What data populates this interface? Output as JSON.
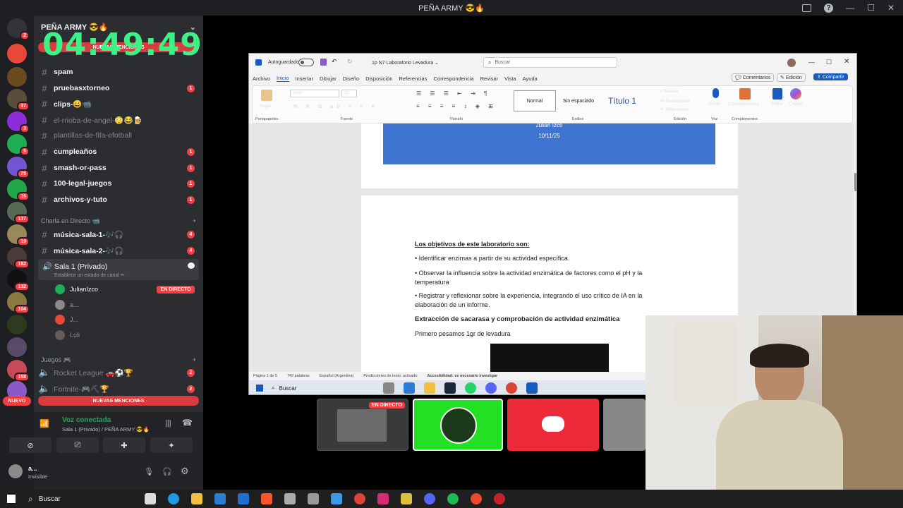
{
  "window": {
    "title": "PEÑA ARMY 😎🔥"
  },
  "guild": {
    "name": "PEÑA ARMY 😎🔥"
  },
  "overlay": {
    "timer": "04:49:49",
    "new_mentions_top": "NUEVAS MENCIONES",
    "new_mentions_bottom": "NUEVAS MENCIONES"
  },
  "servers": {
    "badges": [
      "2",
      "37",
      "3",
      "5",
      "75",
      "16",
      "137",
      "19",
      "182",
      "132",
      "104",
      "158"
    ],
    "nuevo": "NUEVO"
  },
  "channels": [
    {
      "name": "spam",
      "style": "bold",
      "count": ""
    },
    {
      "name": "pruebasxtorneo",
      "style": "bold",
      "count": "1"
    },
    {
      "name": "clips-😀📹",
      "style": "bold",
      "count": ""
    },
    {
      "name": "el-rrioba-de-angel-😳😂🍺",
      "style": "dim",
      "count": ""
    },
    {
      "name": "plantillas-de-fifa-efotball",
      "style": "dim",
      "count": ""
    },
    {
      "name": "cumpleaños",
      "style": "bold",
      "count": "1"
    },
    {
      "name": "smash-or-pass",
      "style": "bold",
      "count": "1"
    },
    {
      "name": "100-legal-juegos",
      "style": "bold",
      "count": "1"
    },
    {
      "name": "archivos-y-tuto",
      "style": "bold",
      "count": "1"
    }
  ],
  "category_live": {
    "label": "Charla en Directo 📹"
  },
  "voice_channels": [
    {
      "name": "música-sala-1-🎶🎧",
      "count": "4"
    },
    {
      "name": "música-sala-2-🎶🎧",
      "count": "4"
    }
  ],
  "voice_room": {
    "name": "Sala 1 (Privado)",
    "status_placeholder": "Establece un estado de canal ✏"
  },
  "voice_users": [
    {
      "name": "JulianIzco",
      "live": "EN DIRECTO"
    },
    {
      "name": "a..."
    },
    {
      "name": "J..."
    },
    {
      "name": "Luli"
    }
  ],
  "category_games": {
    "label": "Juegos 🎮"
  },
  "game_channels": [
    {
      "name": "Rocket League 🚗⚽🏆",
      "count": "2"
    },
    {
      "name": "Fortnite-🎮⛏🏆",
      "count": "2"
    }
  ],
  "voice_panel": {
    "status": "Voz conectada",
    "location": "Sala 1 (Privado) / PEÑA ARMY 😎🔥"
  },
  "user_panel": {
    "name": "a...",
    "status": "Invisible"
  },
  "word": {
    "autosave_label": "Autoguardado",
    "doc_title": "1p N7 Laboratorio Levadura ⌄",
    "search_placeholder": "Buscar",
    "menu": [
      "Archivo",
      "Inicio",
      "Insertar",
      "Dibujar",
      "Diseño",
      "Disposición",
      "Referencias",
      "Correspondencia",
      "Revisar",
      "Vista",
      "Ayuda"
    ],
    "comments": "Comentarios",
    "editing": "Edición",
    "share": "Compartir",
    "paste": "Pegar",
    "font": "Arial",
    "size": "11",
    "styles": [
      "Normal",
      "Sin espaciado",
      "Título 1"
    ],
    "find": "Buscar",
    "replace": "Reemplazar",
    "select": "Seleccionar",
    "dictate": "Dictar",
    "addins": "Complementos",
    "editor": "Editor",
    "copilot": "Copilot",
    "groups": [
      "Portapapeles",
      "Fuente",
      "Párrafo",
      "Estilos",
      "Edición",
      "Voz",
      "Complementos"
    ],
    "cover_author": "Julian Izco",
    "cover_date": "10/11/25",
    "heading": "Los objetivos de este laboratorio son:",
    "bullets": [
      "• Identificar enzimas a partir de su actividad específica.",
      "• Observar la influencia sobre la actividad enzimática de factores como el pH y la temperatura",
      "• Registrar y reflexionar sobre la experiencia, integrando el uso crítico de IA en la elaboración de un informe."
    ],
    "section_title": "Extracción de sacarasa y comprobación de actividad enzimática",
    "paragraph": "Primero pesamos 1gr de levadura",
    "status": [
      "Página 1 de 5",
      "742 palabras",
      "Español (Argentina)",
      "Predicciones de texto: activado",
      "Accesibilidad: es necesario investigar"
    ],
    "inner_search": "Buscar"
  },
  "stream_tiles": {
    "live": "EN DIRECTO"
  },
  "taskbar": {
    "search": "Buscar"
  }
}
